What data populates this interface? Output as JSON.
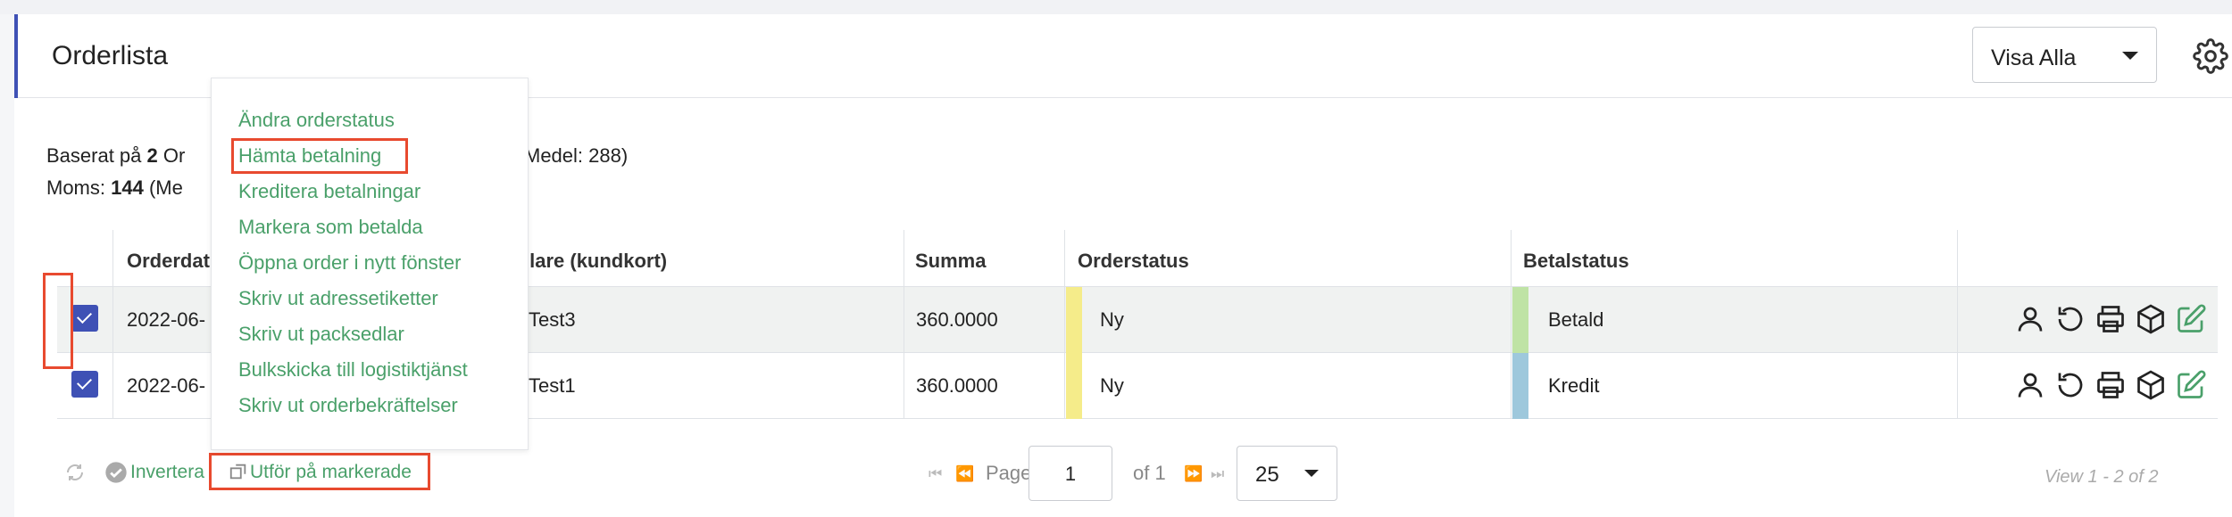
{
  "header": {
    "title": "Orderlista",
    "view_select": "Visa Alla"
  },
  "summary": {
    "line1_prefix": "Baserat på ",
    "line1_count": "2",
    "line1_rest": " Or",
    "line1_tail": "Medel: 288)",
    "line2_label": "Moms: ",
    "line2_value": "144",
    "line2_rest": " (Me"
  },
  "table": {
    "columns": [
      "Orderdat",
      "llare (kundkort)",
      "Summa",
      "Orderstatus",
      "Betalstatus"
    ],
    "rows": [
      {
        "date": "2022-06-",
        "customer": "Test3",
        "sum": "360.0000",
        "order_status": "Ny",
        "order_status_color": "#f5ec8a",
        "pay_status": "Betald",
        "pay_status_color": "#bfe3a5"
      },
      {
        "date": "2022-06-",
        "customer": "Test1",
        "sum": "360.0000",
        "order_status": "Ny",
        "order_status_color": "#f5ec8a",
        "pay_status": "Kredit",
        "pay_status_color": "#9ec8dc"
      }
    ]
  },
  "menu": {
    "items": [
      "Ändra orderstatus",
      "Hämta betalning",
      "Kreditera betalningar",
      "Markera som betalda",
      "Öppna order i nytt fönster",
      "Skriv ut adressetiketter",
      "Skriv ut packsedlar",
      "Bulkskicka till logistiktjänst",
      "Skriv ut orderbekräftelser"
    ]
  },
  "footer": {
    "invert": "Invertera",
    "execute": "Utför på markerade",
    "page_label": "Page",
    "page_value": "1",
    "of_label": "of 1",
    "per_page": "25",
    "view_count": "View 1 - 2 of 2"
  },
  "colors": {
    "accent": "#3f51b5",
    "link_green": "#4aa06a",
    "highlight_red": "#e84a2f"
  },
  "icons": [
    "user-icon",
    "refresh-icon",
    "print-icon",
    "package-icon",
    "edit-icon"
  ]
}
